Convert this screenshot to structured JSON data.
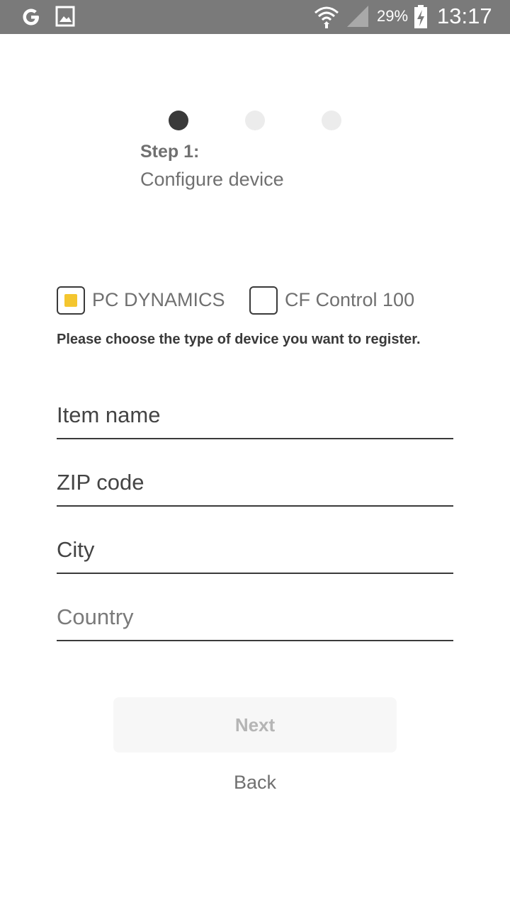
{
  "status_bar": {
    "battery_percent": "29%",
    "time": "13:17",
    "icons": [
      "google-icon",
      "gallery-icon",
      "wifi-icon",
      "signal-icon",
      "battery-charging-icon"
    ],
    "background": "#7a7a7a"
  },
  "stepper": {
    "current_step": 1,
    "total_steps": 3,
    "step_label": "Step 1:",
    "step_description": "Configure device"
  },
  "device_type": {
    "options": [
      {
        "label": "PC DYNAMICS",
        "checked": true
      },
      {
        "label": "CF Control 100",
        "checked": false
      }
    ],
    "hint": "Please choose the type of device you want to register."
  },
  "form": {
    "item_name_placeholder": "Item name",
    "zip_placeholder": "ZIP code",
    "city_placeholder": "City",
    "country_placeholder": "Country"
  },
  "actions": {
    "next_label": "Next",
    "back_label": "Back"
  },
  "colors": {
    "accent": "#f4c62f",
    "active_dot": "#3a3a3a",
    "inactive_dot": "#ececec"
  }
}
